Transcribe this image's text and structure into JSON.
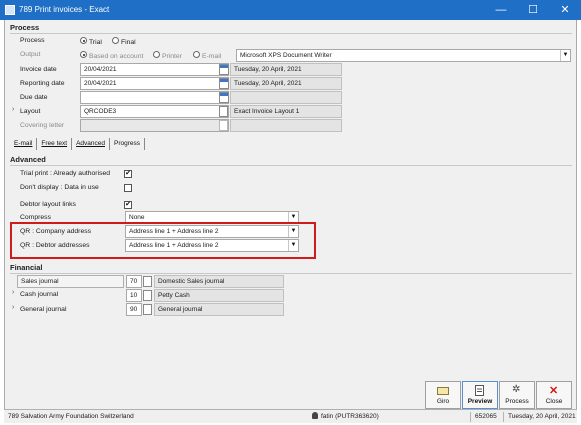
{
  "window": {
    "title": "789 Print invoices - Exact",
    "minimize": "—",
    "maximize": "☐",
    "close": "✕"
  },
  "process": {
    "section": "Process",
    "process_label": "Process",
    "trial": "Trial",
    "final": "Final",
    "output_label": "Output",
    "based_on_account": "Based on account",
    "printer": "Printer",
    "email": "E-mail",
    "output_device": "Microsoft XPS Document Writer",
    "invoice_date_label": "Invoice date",
    "invoice_date": "20/04/2021",
    "invoice_date_long": "Tuesday, 20 April, 2021",
    "reporting_date_label": "Reporting date",
    "reporting_date": "20/04/2021",
    "reporting_date_long": "Tuesday, 20 April, 2021",
    "due_date_label": "Due date",
    "layout_label": "Layout",
    "layout_code": "QRCODE3",
    "layout_name": "Exact Invoice Layout 1",
    "covering_letter_label": "Covering letter"
  },
  "tabs": [
    "E-mail",
    "Free text",
    "Advanced",
    "Progress"
  ],
  "advanced": {
    "section": "Advanced",
    "trial_print_label": "Trial print : Already authorised",
    "dont_display_label": "Don't display : Data in use",
    "debtor_layout_links_label": "Debtor layout links",
    "compress_label": "Compress",
    "compress_value": "None",
    "qr_company_label": "QR : Company address",
    "qr_company_value": "Address line 1 + Address line 2",
    "qr_debtor_label": "QR : Debtor addresses",
    "qr_debtor_value": "Address line 1 + Address line 2"
  },
  "financial": {
    "section": "Financial",
    "sales_journal_label": "Sales journal",
    "sales_journal_code": "70",
    "sales_journal_name": "Domestic Sales journal",
    "cash_journal_label": "Cash journal",
    "cash_journal_code": "10",
    "cash_journal_name": "Petty Cash",
    "general_journal_label": "General journal",
    "general_journal_code": "90",
    "general_journal_name": "General journal"
  },
  "buttons": {
    "giro": "Giro",
    "preview": "Preview",
    "process": "Process",
    "close": "Close"
  },
  "status": {
    "company": "789 Salvation Army Foundation Switzerland",
    "user": "fatin (PUTR363620)",
    "code": "652065",
    "date": "Tuesday, 20 April, 2021"
  },
  "colors": {
    "titlebar": "#1f6fc6",
    "highlight_box": "#d11a1a"
  }
}
